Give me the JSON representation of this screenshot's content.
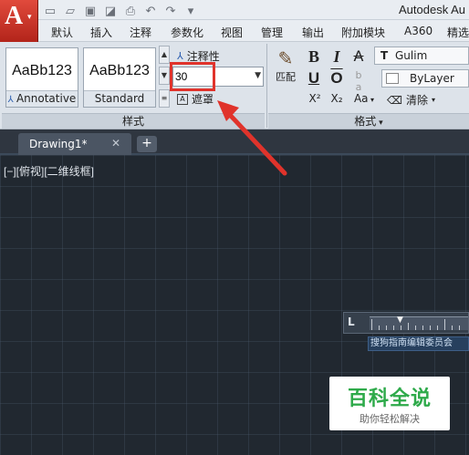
{
  "window": {
    "title": "Autodesk Au"
  },
  "app_button": {
    "logo": "A",
    "dropdown": "▾"
  },
  "quick_access": {
    "icons": [
      "new-icon",
      "open-icon",
      "save-icon",
      "save-as-icon",
      "print-icon",
      "undo-icon",
      "redo-icon",
      "customize-icon"
    ]
  },
  "ribbon_tabs": [
    "默认",
    "插入",
    "注释",
    "参数化",
    "视图",
    "管理",
    "输出",
    "附加模块",
    "A360",
    "精选"
  ],
  "text_styles": {
    "samples": [
      {
        "preview": "AaBb123",
        "name": "Annotative"
      },
      {
        "preview": "AaBb123",
        "name": "Standard"
      }
    ],
    "annotative_label": "注释性",
    "height_value": "30",
    "mask_label": "遮罩",
    "panel_label": "样式"
  },
  "format_panel": {
    "match_label": "匹配",
    "bold": "B",
    "italic": "I",
    "strike": "A",
    "underline": "U",
    "overline": "O",
    "case": "b a",
    "superscript": "X²",
    "subscript": "X₂",
    "case_dropdown": "Aa",
    "font": "Gulim",
    "color": "ByLayer",
    "clear_label": "清除",
    "panel_label": "格式"
  },
  "document_tabs": {
    "active": "Drawing1*",
    "close": "✕",
    "new": "+"
  },
  "viewport": {
    "label": "[−][俯视][二维线框]"
  },
  "text_editor": {
    "ruler_icon": "L",
    "label": "搜狗指南编辑委员会"
  },
  "watermark": {
    "title": "百科全说",
    "subtitle": "助你轻松解决"
  },
  "colors": {
    "app_red": "#c8281e",
    "highlight_red": "#e0332b",
    "canvas": "#212830"
  }
}
